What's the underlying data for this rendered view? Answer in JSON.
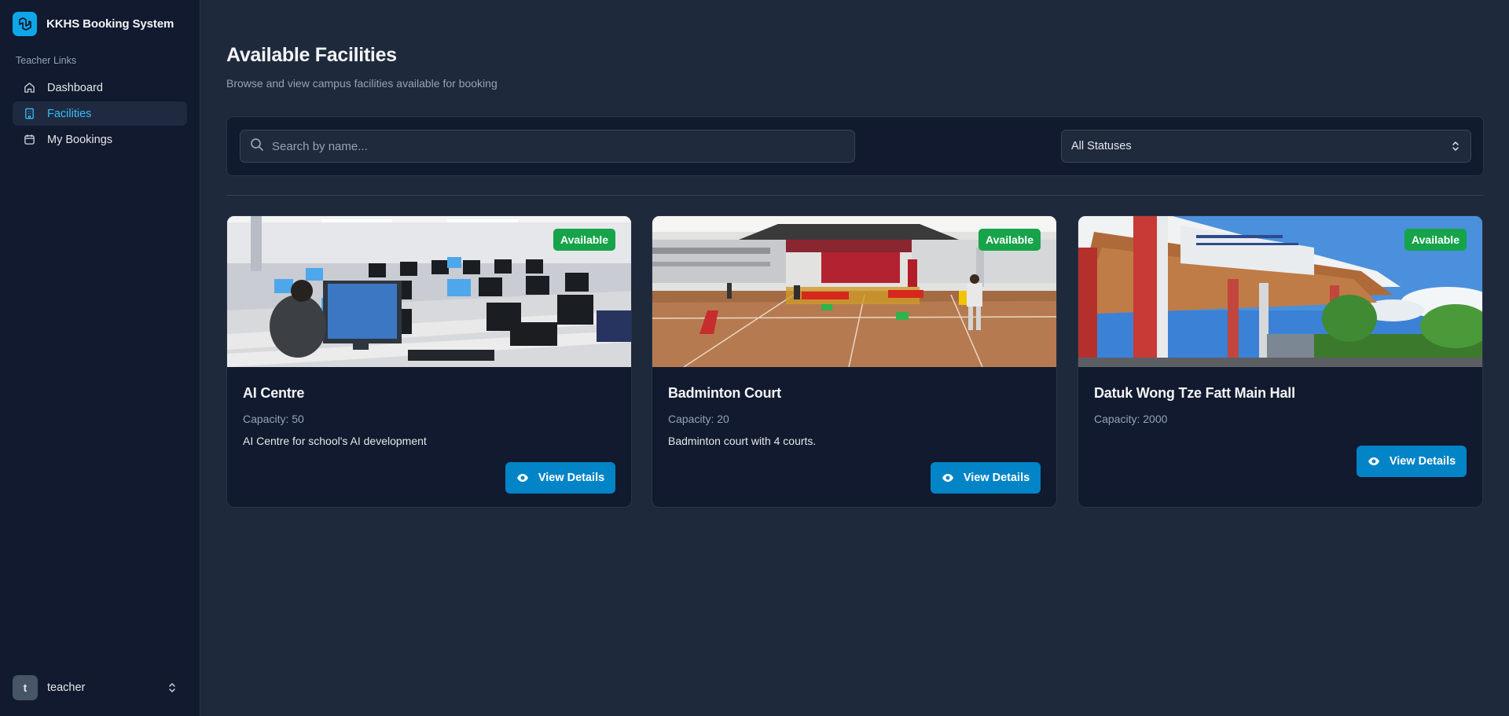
{
  "app": {
    "title": "KKHS Booking System"
  },
  "sidebar": {
    "section_label": "Teacher Links",
    "items": [
      {
        "label": "Dashboard",
        "icon": "home-icon",
        "active": false
      },
      {
        "label": "Facilities",
        "icon": "building-icon",
        "active": true
      },
      {
        "label": "My Bookings",
        "icon": "calendar-icon",
        "active": false
      }
    ],
    "user": {
      "initial": "t",
      "name": "teacher"
    }
  },
  "main": {
    "title": "Available Facilities",
    "subtitle": "Browse and view campus facilities available for booking",
    "search": {
      "placeholder": "Search by name...",
      "value": ""
    },
    "status_filter": {
      "selected": "All Statuses"
    }
  },
  "facilities": [
    {
      "name": "AI Centre",
      "capacity": "Capacity: 50",
      "description": "AI Centre for school's AI development",
      "status": "Available",
      "action": "View Details",
      "image": "computer-lab-photo"
    },
    {
      "name": "Badminton Court",
      "capacity": "Capacity: 20",
      "description": "Badminton court with 4 courts.",
      "status": "Available",
      "action": "View Details",
      "image": "badminton-hall-photo"
    },
    {
      "name": "Datuk Wong Tze Fatt Main Hall",
      "capacity": "Capacity: 2000",
      "description": "",
      "status": "Available",
      "action": "View Details",
      "image": "main-hall-entrance-photo"
    }
  ],
  "colors": {
    "accent": "#38bdf8",
    "primary_button": "#0284c7",
    "status_available": "#16a34a",
    "background": "#1e293b",
    "sidebar": "#111a2e"
  }
}
